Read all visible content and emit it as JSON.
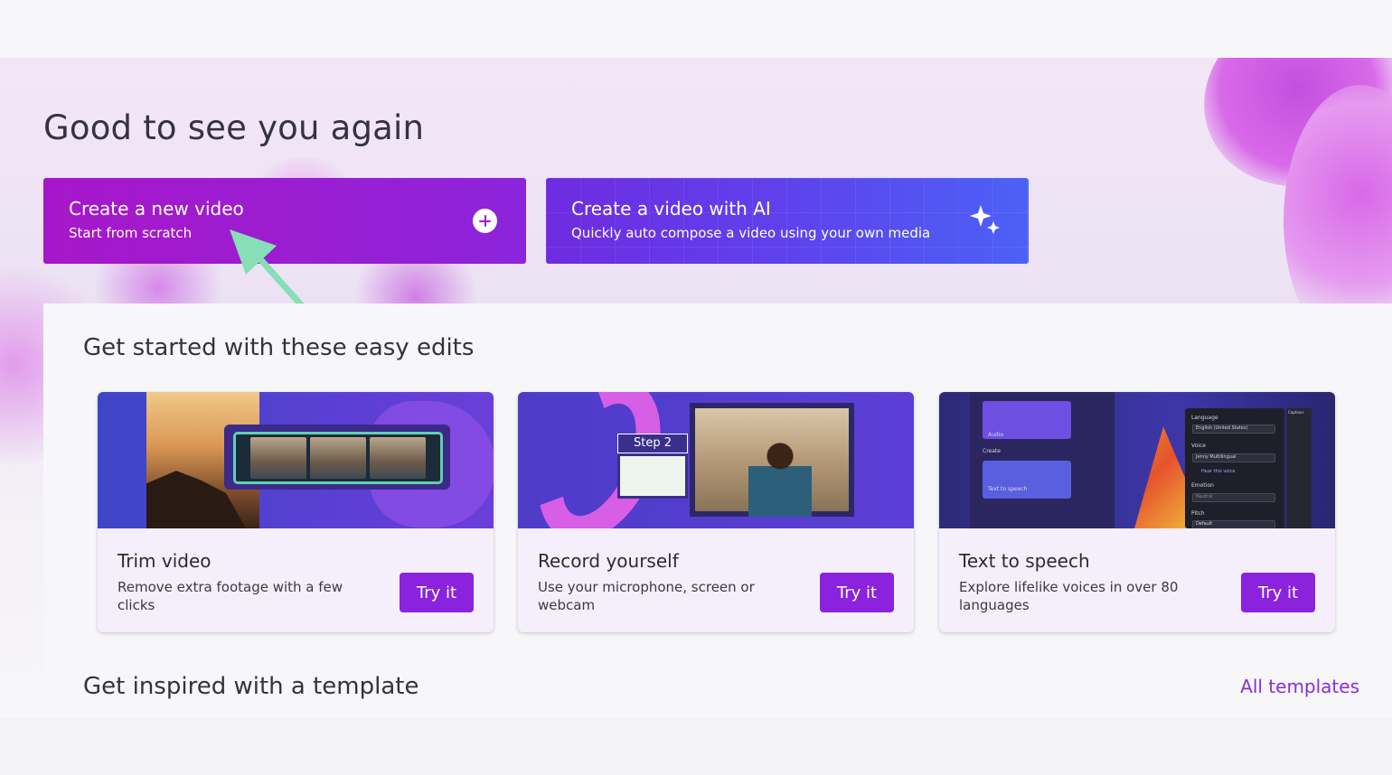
{
  "hero": {
    "title": "Good to see you again",
    "new_video": {
      "title": "Create a new video",
      "subtitle": "Start from scratch"
    },
    "ai_video": {
      "title": "Create a video with AI",
      "subtitle": "Quickly auto compose a video using your own media"
    }
  },
  "sections": {
    "easy_edits": "Get started with these easy edits",
    "templates": "Get inspired with a template",
    "all_templates": "All templates"
  },
  "cards": [
    {
      "title": "Trim video",
      "desc": "Remove extra footage with a few clicks",
      "button": "Try it"
    },
    {
      "title": "Record yourself",
      "desc": "Use your microphone, screen or webcam",
      "button": "Try it",
      "step_label": "Step 2"
    },
    {
      "title": "Text to speech",
      "desc": "Explore lifelike voices in over 80 languages",
      "button": "Try it",
      "thumb_labels": {
        "audio": "Audio",
        "create": "Create",
        "tts": "Text to speech",
        "language": "Language",
        "language_value": "English (United States)",
        "voice": "Voice",
        "voice_value": "Jenny Multilingual",
        "hear": "Hear this voice",
        "emotion": "Emotion",
        "emotion_value": "Neutral",
        "pitch": "Pitch",
        "pitch_value": "Default",
        "captions": "Captions"
      }
    }
  ],
  "colors": {
    "accent": "#8a22de",
    "new_video_card": "#9a1ed2",
    "ai_card": "#5e42ec",
    "annotation_arrow": "#86dfb6"
  }
}
